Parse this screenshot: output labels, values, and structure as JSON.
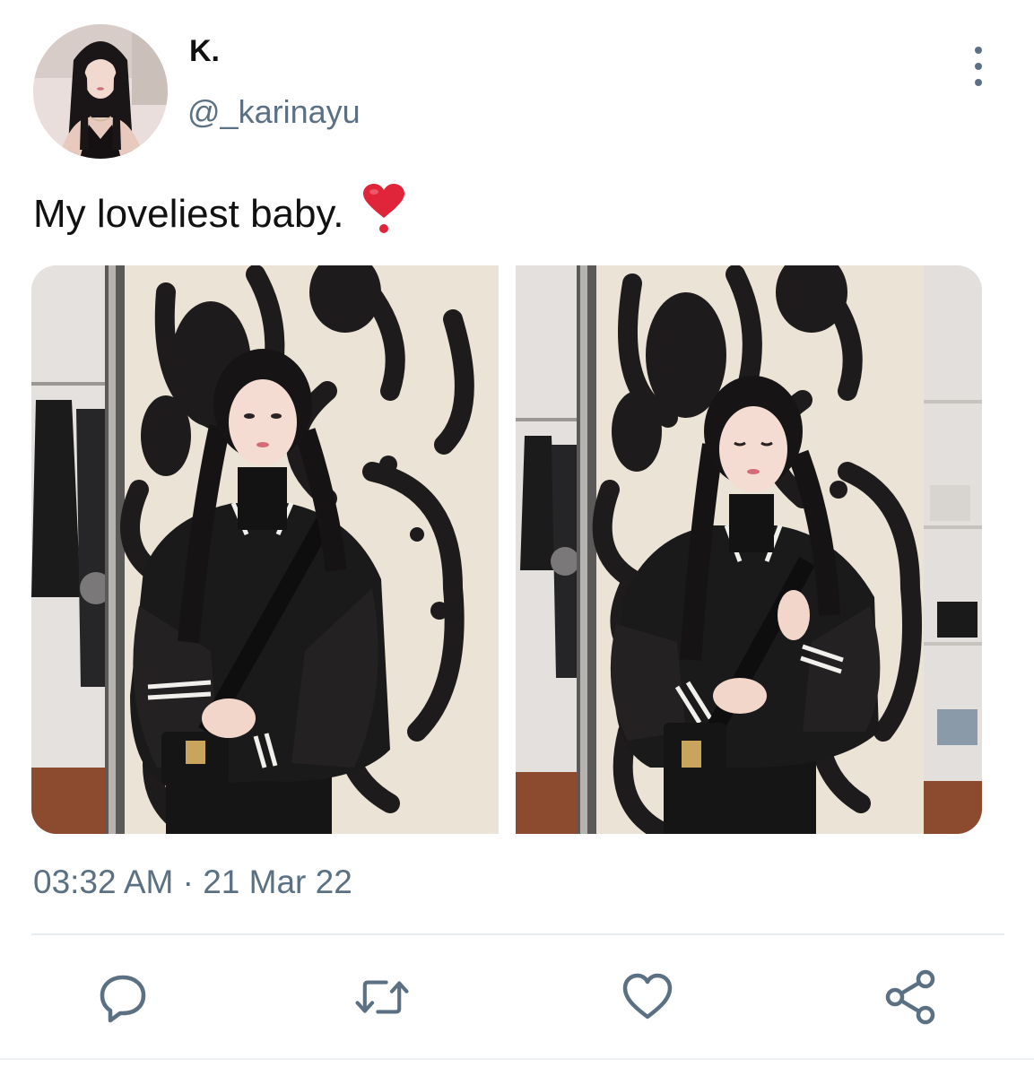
{
  "author": {
    "display_name": "K.",
    "handle": "@_karinayu"
  },
  "tweet": {
    "text": "My loveliest baby.",
    "emoji_icon": "red-heart-exclamation-icon",
    "media_count": 2,
    "timestamp": "03:32 AM · 21 Mar 22"
  },
  "actions": [
    {
      "name": "reply",
      "icon": "speech-bubble-icon"
    },
    {
      "name": "retweet",
      "icon": "retweet-arrows-icon"
    },
    {
      "name": "like",
      "icon": "heart-outline-icon"
    },
    {
      "name": "share",
      "icon": "share-nodes-icon"
    }
  ],
  "colors": {
    "text_primary": "#111111",
    "text_secondary": "#5b7083",
    "divider": "#e6ecf0",
    "heart_emoji": "#e0243a",
    "background": "#ffffff"
  }
}
